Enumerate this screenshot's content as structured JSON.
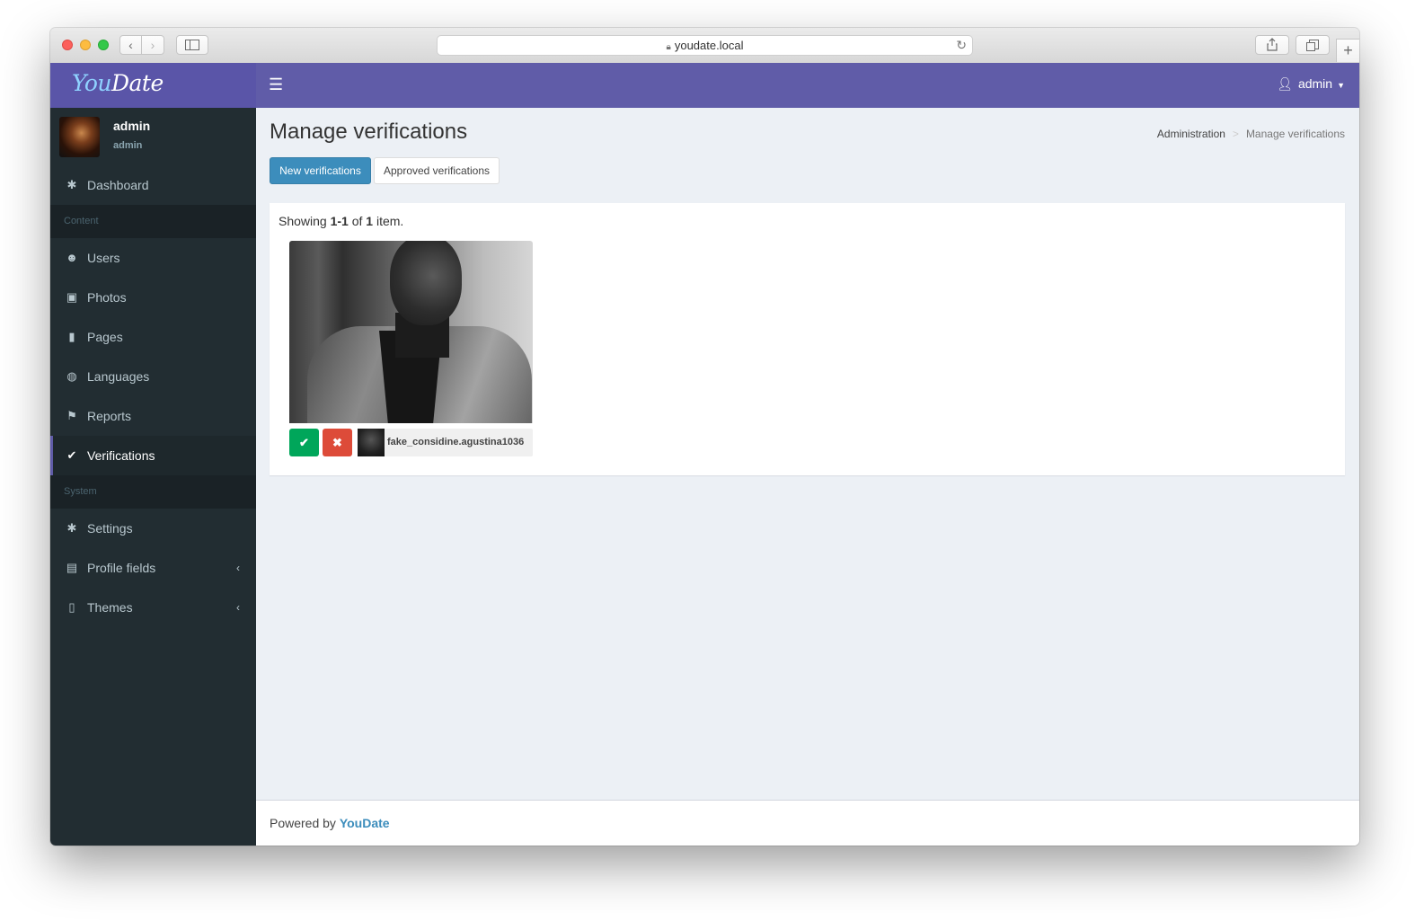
{
  "browser": {
    "url": "youdate.local",
    "back_label": "‹",
    "forward_label": "›",
    "newtab_label": "+"
  },
  "brand": {
    "logo_part1": "You",
    "logo_part2": "Date"
  },
  "user_panel": {
    "name": "admin",
    "role": "admin"
  },
  "sidebar": {
    "items": [
      {
        "label": "Dashboard",
        "icon": "gear-icon"
      },
      {
        "header": "Content"
      },
      {
        "label": "Users",
        "icon": "users-icon"
      },
      {
        "label": "Photos",
        "icon": "image-icon"
      },
      {
        "label": "Pages",
        "icon": "file-icon"
      },
      {
        "label": "Languages",
        "icon": "globe-icon"
      },
      {
        "label": "Reports",
        "icon": "flag-icon"
      },
      {
        "label": "Verifications",
        "icon": "check-circle-icon",
        "active": true
      },
      {
        "header": "System"
      },
      {
        "label": "Settings",
        "icon": "gear-icon"
      },
      {
        "label": "Profile fields",
        "icon": "id-card-icon",
        "has_submenu": true
      },
      {
        "label": "Themes",
        "icon": "theme-file-icon",
        "has_submenu": true
      }
    ]
  },
  "navbar": {
    "user_label": "admin"
  },
  "page": {
    "title": "Manage verifications",
    "breadcrumb": [
      "Administration",
      "Manage verifications"
    ],
    "tabs": [
      {
        "label": "New verifications",
        "active": true
      },
      {
        "label": "Approved verifications",
        "active": false
      }
    ]
  },
  "list": {
    "summary_prefix": "Showing ",
    "summary_range": "1-1",
    "summary_mid": " of ",
    "summary_total": "1",
    "summary_suffix": " item.",
    "items": [
      {
        "username": "fake_considine.agustina1036"
      }
    ]
  },
  "footer": {
    "prefix": "Powered by ",
    "link": "YouDate"
  },
  "colors": {
    "brand_purple": "#605ca8",
    "sidebar_dark": "#222d32",
    "primary_blue": "#3c8dbc",
    "approve_green": "#00a65a",
    "reject_red": "#dd4b39"
  }
}
